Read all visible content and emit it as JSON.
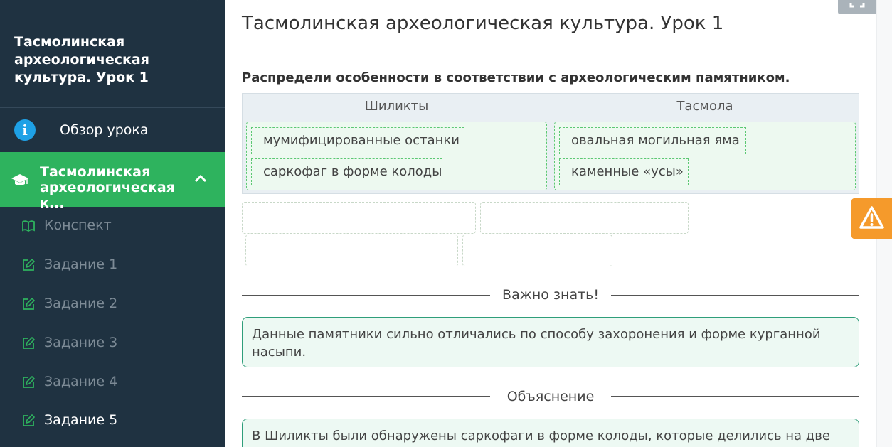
{
  "sidebar": {
    "title": "Тасмолинская археологическая культура. Урок 1",
    "overview": {
      "label": "Обзор урока",
      "icon": "info-icon"
    },
    "active_lesson": {
      "label": "Тасмолинская археологическая к...",
      "icon": "graduation-cap-icon"
    },
    "items": [
      {
        "label": "Конспект",
        "icon": "book-icon"
      },
      {
        "label": "Задание 1",
        "icon": "edit-icon"
      },
      {
        "label": "Задание 2",
        "icon": "edit-icon"
      },
      {
        "label": "Задание 3",
        "icon": "edit-icon"
      },
      {
        "label": "Задание 4",
        "icon": "edit-icon"
      },
      {
        "label": "Задание 5",
        "icon": "edit-icon"
      }
    ]
  },
  "main": {
    "title": "Тасмолинская археологическая культура. Урок 1",
    "task": "Распредели особенности в соответствии с археологическим памятником.",
    "columns": [
      {
        "header": "Шиликты",
        "chips": [
          "мумифицированные останки",
          "саркофаг в форме колоды"
        ]
      },
      {
        "header": "Тасмола",
        "chips": [
          "овальная могильная яма",
          "каменные «усы»"
        ]
      }
    ],
    "important": {
      "heading": "Важно знать!",
      "text": "Данные памятники сильно отличались по способу захоронения и форме курганной насыпи."
    },
    "explanation": {
      "heading": "Объяснение",
      "text": "В Шиликты были обнаружены саркофаги в форме колоды, которые делились на две части."
    }
  },
  "colors": {
    "sidebar_bg": "#1f3241",
    "active_green": "#2eb35e",
    "info_blue": "#1ea1e6",
    "warning_orange": "#f59a2b",
    "dropzone_border": "#5cc873",
    "note_border": "#2f9e7a"
  }
}
